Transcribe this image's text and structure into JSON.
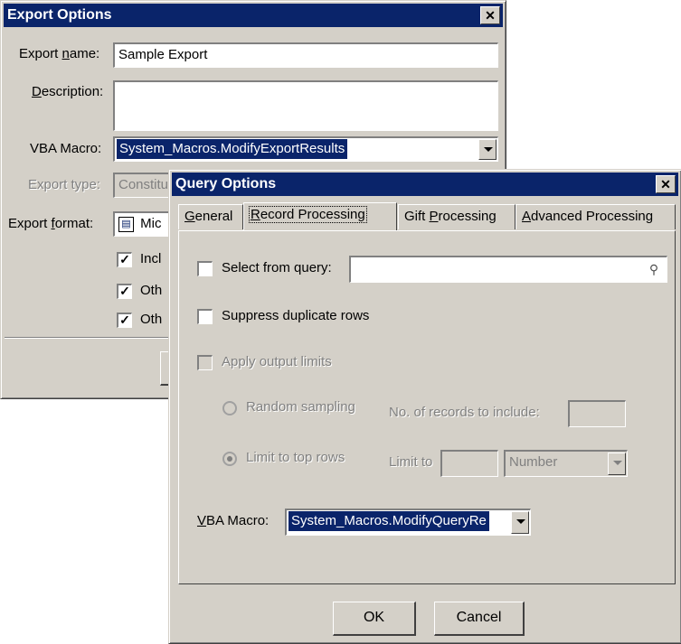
{
  "export_dialog": {
    "title": "Export Options",
    "name_label_pre": "Export ",
    "name_label_acc": "n",
    "name_label_post": "ame:",
    "name_value": "Sample Export",
    "desc_label_acc": "D",
    "desc_label_post": "escription:",
    "desc_value": "",
    "macro_label": "VBA Macro:",
    "macro_value": "System_Macros.ModifyExportResults",
    "type_label": "Export type:",
    "type_value": "Constitu",
    "format_label_pre": "Export ",
    "format_label_acc": "f",
    "format_label_post": "ormat:",
    "format_value": "Mic",
    "checkboxes": [
      {
        "label": "Incl",
        "checked": true
      },
      {
        "label": "Oth",
        "checked": true
      },
      {
        "label": "Oth",
        "checked": true
      }
    ]
  },
  "query_dialog": {
    "title": "Query Options",
    "tabs": [
      {
        "acc": "G",
        "rest": "eneral"
      },
      {
        "acc": "R",
        "rest": "ecord Processing"
      },
      {
        "pre": "Gift ",
        "acc": "P",
        "rest": "rocessing"
      },
      {
        "acc": "A",
        "rest": "dvanced Processing"
      }
    ],
    "select_from_query_label": "Select from query:",
    "select_from_query_value": "",
    "suppress_duplicates_label": "Suppress duplicate rows",
    "apply_limits_label": "Apply output limits",
    "random_sampling_label": "Random sampling",
    "num_records_label": "No. of records to include:",
    "num_records_value": "",
    "limit_top_label": "Limit to top rows",
    "limit_to_label": "Limit to",
    "limit_to_value": "",
    "limit_unit_value": "Number",
    "macro_label_acc": "V",
    "macro_label_post": "BA Macro:",
    "macro_value": "System_Macros.ModifyQueryRe",
    "ok_label": "OK",
    "cancel_label": "Cancel"
  },
  "icons": {
    "close": "close-icon",
    "binoculars": "binoculars-icon",
    "checkmark": "✓"
  }
}
